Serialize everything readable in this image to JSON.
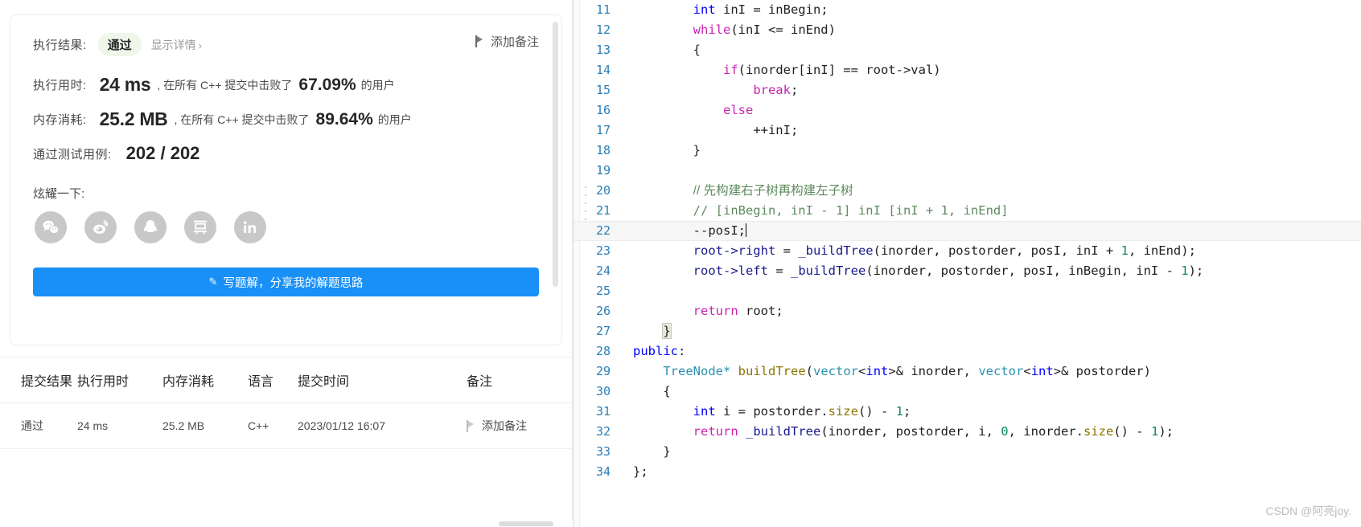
{
  "result_panel": {
    "status_label": "执行结果:",
    "status_value": "通过",
    "detail_link": "显示详情",
    "detail_chevron": "›",
    "add_note_top": "添加备注",
    "runtime_label": "执行用时:",
    "runtime_value": "24 ms",
    "runtime_mid": ", 在所有 C++ 提交中击败了",
    "runtime_pct": "67.09%",
    "runtime_tail": "的用户",
    "memory_label": "内存消耗:",
    "memory_value": "25.2 MB",
    "memory_mid": ", 在所有 C++ 提交中击败了",
    "memory_pct": "89.64%",
    "memory_tail": "的用户",
    "testcases_label": "通过测试用例:",
    "testcases_value": "202 / 202",
    "share_label": "炫耀一下:",
    "share_buttons": [
      {
        "name": "wechat-icon",
        "title": "微信"
      },
      {
        "name": "weibo-icon",
        "title": "微博"
      },
      {
        "name": "qq-icon",
        "title": "QQ"
      },
      {
        "name": "douban-icon",
        "title": "豆瓣"
      },
      {
        "name": "linkedin-icon",
        "title": "LinkedIn"
      }
    ],
    "write_solution_button": "写题解，分享我的解题思路",
    "accent_color": "#1890f6",
    "pass_color": "#5cb85c"
  },
  "submissions_table": {
    "headers": [
      "提交结果",
      "执行用时",
      "内存消耗",
      "语言",
      "提交时间",
      "备注"
    ],
    "rows": [
      {
        "result": "通过",
        "runtime": "24 ms",
        "memory": "25.2 MB",
        "language": "C++",
        "time": "2023/01/12 16:07",
        "note": "添加备注"
      }
    ]
  },
  "editor": {
    "first_line_number": 11,
    "active_line": 22,
    "watermark": "CSDN @阿亮joy.",
    "lines": [
      {
        "n": 11,
        "indent": 2,
        "tokens": [
          {
            "t": "int",
            "c": "kwb"
          },
          {
            "t": " inI = inBegin;",
            "c": "plain"
          }
        ]
      },
      {
        "n": 12,
        "indent": 2,
        "tokens": [
          {
            "t": "while",
            "c": "kw"
          },
          {
            "t": "(inI <= inEnd)",
            "c": "plain"
          }
        ]
      },
      {
        "n": 13,
        "indent": 2,
        "tokens": [
          {
            "t": "{",
            "c": "plain"
          }
        ]
      },
      {
        "n": 14,
        "indent": 3,
        "tokens": [
          {
            "t": "if",
            "c": "kw"
          },
          {
            "t": "(inorder[inI] == root->val)",
            "c": "plain"
          }
        ]
      },
      {
        "n": 15,
        "indent": 4,
        "tokens": [
          {
            "t": "break",
            "c": "kw"
          },
          {
            "t": ";",
            "c": "plain"
          }
        ]
      },
      {
        "n": 16,
        "indent": 3,
        "tokens": [
          {
            "t": "else",
            "c": "kw"
          }
        ]
      },
      {
        "n": 17,
        "indent": 4,
        "tokens": [
          {
            "t": "++inI;",
            "c": "plain"
          }
        ]
      },
      {
        "n": 18,
        "indent": 2,
        "tokens": [
          {
            "t": "}",
            "c": "plain"
          }
        ]
      },
      {
        "n": 19,
        "indent": 0,
        "tokens": []
      },
      {
        "n": 20,
        "indent": 2,
        "tokens": [
          {
            "t": "// 先构建右子树再构建左子树",
            "c": "cmt-cn"
          }
        ]
      },
      {
        "n": 21,
        "indent": 2,
        "tokens": [
          {
            "t": "// [inBegin, inI - 1] inI [inI + 1, inEnd]",
            "c": "cmt"
          }
        ]
      },
      {
        "n": 22,
        "indent": 2,
        "tokens": [
          {
            "t": "--posI;",
            "c": "plain"
          }
        ]
      },
      {
        "n": 23,
        "indent": 2,
        "tokens": [
          {
            "t": "root->right",
            "c": "id"
          },
          {
            "t": " = ",
            "c": "plain"
          },
          {
            "t": "_buildTree",
            "c": "id"
          },
          {
            "t": "(inorder, postorder, posI, inI + ",
            "c": "plain"
          },
          {
            "t": "1",
            "c": "num"
          },
          {
            "t": ", inEnd);",
            "c": "plain"
          }
        ]
      },
      {
        "n": 24,
        "indent": 2,
        "tokens": [
          {
            "t": "root->left",
            "c": "id"
          },
          {
            "t": " = ",
            "c": "plain"
          },
          {
            "t": "_buildTree",
            "c": "id"
          },
          {
            "t": "(inorder, postorder, posI, inBegin, inI - ",
            "c": "plain"
          },
          {
            "t": "1",
            "c": "num"
          },
          {
            "t": ");",
            "c": "plain"
          }
        ]
      },
      {
        "n": 25,
        "indent": 0,
        "tokens": []
      },
      {
        "n": 26,
        "indent": 2,
        "tokens": [
          {
            "t": "return",
            "c": "kw"
          },
          {
            "t": " root;",
            "c": "plain"
          }
        ]
      },
      {
        "n": 27,
        "indent": 1,
        "tokens": [
          {
            "t": "}",
            "c": "brk"
          }
        ]
      },
      {
        "n": 28,
        "indent": 0,
        "tokens": [
          {
            "t": "public",
            "c": "kwb"
          },
          {
            "t": ":",
            "c": "plain"
          }
        ]
      },
      {
        "n": 29,
        "indent": 1,
        "tokens": [
          {
            "t": "TreeNode*",
            "c": "typ"
          },
          {
            "t": " ",
            "c": "plain"
          },
          {
            "t": "buildTree",
            "c": "fn"
          },
          {
            "t": "(",
            "c": "plain"
          },
          {
            "t": "vector",
            "c": "typ"
          },
          {
            "t": "<",
            "c": "plain"
          },
          {
            "t": "int",
            "c": "kwb"
          },
          {
            "t": ">& inorder, ",
            "c": "plain"
          },
          {
            "t": "vector",
            "c": "typ"
          },
          {
            "t": "<",
            "c": "plain"
          },
          {
            "t": "int",
            "c": "kwb"
          },
          {
            "t": ">& postorder)",
            "c": "plain"
          }
        ]
      },
      {
        "n": 30,
        "indent": 1,
        "tokens": [
          {
            "t": "{",
            "c": "plain"
          }
        ]
      },
      {
        "n": 31,
        "indent": 2,
        "tokens": [
          {
            "t": "int",
            "c": "kwb"
          },
          {
            "t": " i = postorder.",
            "c": "plain"
          },
          {
            "t": "size",
            "c": "fn"
          },
          {
            "t": "() - ",
            "c": "plain"
          },
          {
            "t": "1",
            "c": "num"
          },
          {
            "t": ";",
            "c": "plain"
          }
        ]
      },
      {
        "n": 32,
        "indent": 2,
        "tokens": [
          {
            "t": "return",
            "c": "kw"
          },
          {
            "t": " ",
            "c": "plain"
          },
          {
            "t": "_buildTree",
            "c": "id"
          },
          {
            "t": "(inorder, postorder, i, ",
            "c": "plain"
          },
          {
            "t": "0",
            "c": "num"
          },
          {
            "t": ", inorder.",
            "c": "plain"
          },
          {
            "t": "size",
            "c": "fn"
          },
          {
            "t": "() - ",
            "c": "plain"
          },
          {
            "t": "1",
            "c": "num"
          },
          {
            "t": ");",
            "c": "plain"
          }
        ]
      },
      {
        "n": 33,
        "indent": 1,
        "tokens": [
          {
            "t": "}",
            "c": "plain"
          }
        ]
      },
      {
        "n": 34,
        "indent": 0,
        "tokens": [
          {
            "t": "};",
            "c": "plain"
          }
        ]
      }
    ]
  }
}
